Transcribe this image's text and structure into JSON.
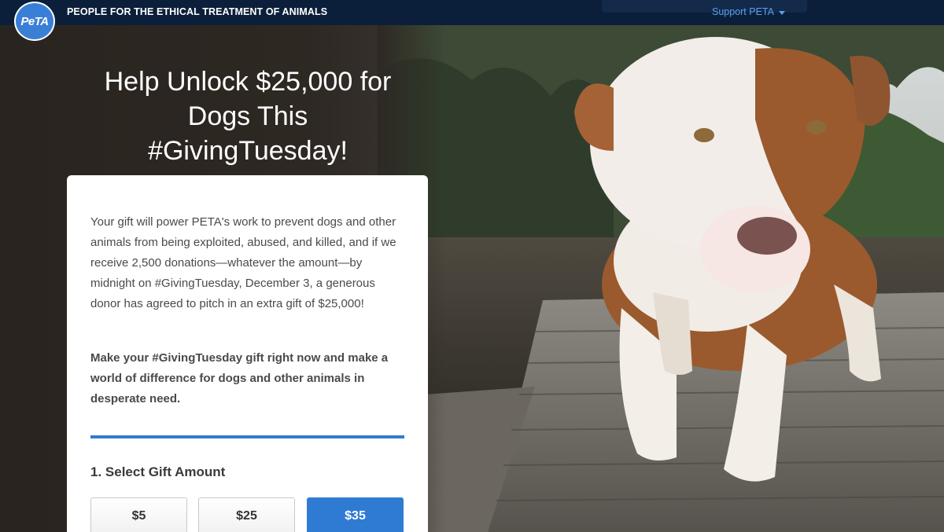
{
  "header": {
    "logo_text": "PeTA",
    "org_name": "PEOPLE FOR THE ETHICAL TREATMENT OF ANIMALS",
    "support_label": "Support PETA"
  },
  "hero": {
    "headline": "Help Unlock $25,000 for Dogs This #GivingTuesday!"
  },
  "card": {
    "paragraph1": "Your gift will power PETA's work to prevent dogs and other animals from being exploited, abused, and killed, and if we receive 2,500 donations—whatever the amount—by midnight on #GivingTuesday, December 3, a generous donor has agreed to pitch in an extra gift of $25,000!",
    "paragraph2": "Make your #GivingTuesday gift right now and make a world of difference for dogs and other animals in desperate need.",
    "step_title": "1. Select Gift Amount",
    "amounts": [
      "$5",
      "$25",
      "$35"
    ],
    "selected_amount": "$35"
  },
  "colors": {
    "topbar": "#0b1f3a",
    "accent": "#2f7bd4",
    "link": "#5aa0f0"
  }
}
